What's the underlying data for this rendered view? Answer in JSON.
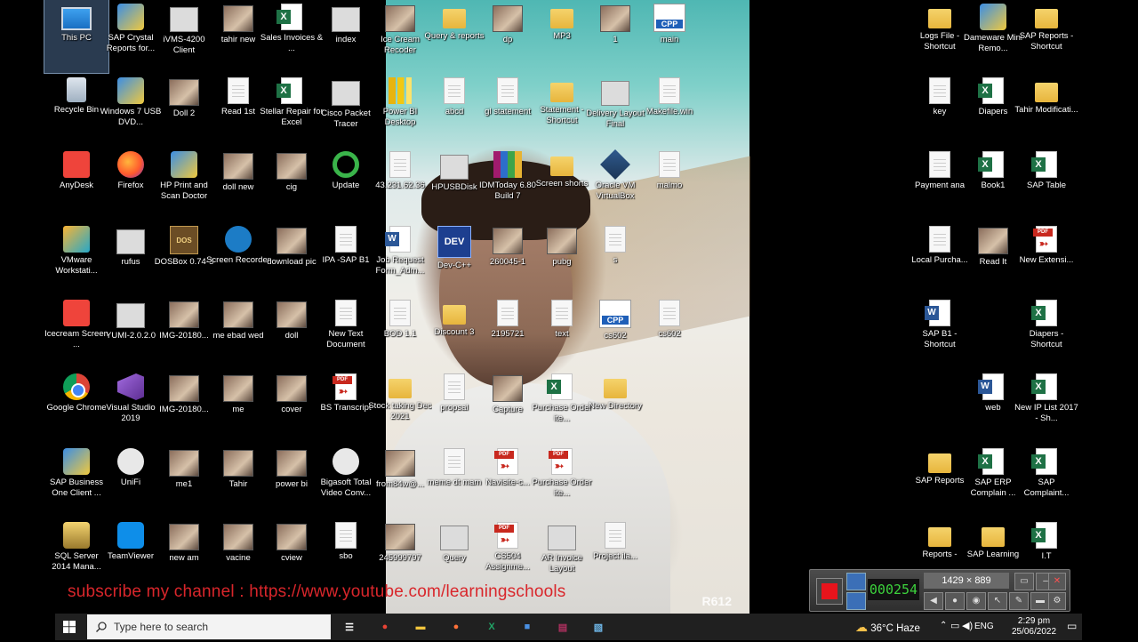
{
  "desktop": {
    "col1": [
      {
        "label": "This PC",
        "icon": "this-pc-icon",
        "type": "pc",
        "selected": true
      },
      {
        "label": "Recycle Bin",
        "icon": "recycle-bin-icon",
        "type": "recycle"
      },
      {
        "label": "AnyDesk",
        "icon": "anydesk-icon",
        "type": "any"
      },
      {
        "label": "VMware Workstati...",
        "icon": "vmware-icon",
        "type": "vmware"
      },
      {
        "label": "Icecream Screen ...",
        "icon": "icecream-icon",
        "type": "any"
      },
      {
        "label": "Google Chrome",
        "icon": "chrome-icon",
        "type": "chrome"
      },
      {
        "label": "SAP Business One Client ...",
        "icon": "sap-business-one-icon",
        "type": "shield"
      },
      {
        "label": "SQL Server 2014 Mana...",
        "icon": "sql-server-icon",
        "type": "sql"
      }
    ],
    "col2": [
      {
        "label": "SAP Crystal Reports for...",
        "icon": "crystal-reports-icon",
        "type": "shield"
      },
      {
        "label": "Windows 7 USB DVD...",
        "icon": "windows-usb-icon",
        "type": "shield"
      },
      {
        "label": "Firefox",
        "icon": "firefox-icon",
        "type": "firefox"
      },
      {
        "label": "rufus",
        "icon": "rufus-icon",
        "type": "gray"
      },
      {
        "label": "YUMI-2.0.2.0",
        "icon": "yumi-icon",
        "type": "gray"
      },
      {
        "label": "Visual Studio 2019",
        "icon": "visual-studio-icon",
        "type": "vs"
      },
      {
        "label": "UniFi",
        "icon": "unifi-icon",
        "type": "whiteround"
      },
      {
        "label": "TeamViewer",
        "icon": "teamviewer-icon",
        "type": "teamviewer"
      }
    ],
    "col3": [
      {
        "label": "iVMS-4200 Client",
        "icon": "ivms-icon",
        "type": "gray"
      },
      {
        "label": "Doll 2",
        "icon": "image-icon",
        "type": "photo"
      },
      {
        "label": "HP Print and Scan Doctor",
        "icon": "hp-doctor-icon",
        "type": "shield"
      },
      {
        "label": "DOSBox 0.74-3",
        "icon": "dosbox-icon",
        "type": "box",
        "glyph": "DOS"
      },
      {
        "label": "IMG-20180...",
        "icon": "image-icon",
        "type": "photo"
      },
      {
        "label": "IMG-20180...",
        "icon": "image-icon",
        "type": "photo"
      },
      {
        "label": "me1",
        "icon": "image-icon",
        "type": "photo"
      },
      {
        "label": "new am",
        "icon": "image-icon",
        "type": "photo"
      }
    ],
    "col4": [
      {
        "label": "tahir new",
        "icon": "image-icon",
        "type": "photo"
      },
      {
        "label": "Read 1st",
        "icon": "text-file-icon",
        "type": "doc"
      },
      {
        "label": "doll new",
        "icon": "image-icon",
        "type": "photo"
      },
      {
        "label": "Screen Recorder",
        "icon": "screen-recorder-icon",
        "type": "blue"
      },
      {
        "label": "me ebad wed",
        "icon": "image-icon",
        "type": "photo"
      },
      {
        "label": "me",
        "icon": "image-icon",
        "type": "photo"
      },
      {
        "label": "Tahir",
        "icon": "image-icon",
        "type": "photo"
      },
      {
        "label": "vacine",
        "icon": "image-icon",
        "type": "photo"
      }
    ],
    "col5": [
      {
        "label": "Sales Invoices & ...",
        "icon": "excel-file-icon",
        "type": "xls"
      },
      {
        "label": "Stellar Repair for Excel",
        "icon": "stellar-repair-icon",
        "type": "xls"
      },
      {
        "label": "cig",
        "icon": "image-icon",
        "type": "photo"
      },
      {
        "label": "download pic",
        "icon": "image-icon",
        "type": "photo"
      },
      {
        "label": "doll",
        "icon": "image-icon",
        "type": "photo"
      },
      {
        "label": "cover",
        "icon": "image-icon",
        "type": "photo"
      },
      {
        "label": "power bi",
        "icon": "image-icon",
        "type": "photo"
      },
      {
        "label": "cview",
        "icon": "image-icon",
        "type": "photo"
      }
    ],
    "col6": [
      {
        "label": "index",
        "icon": "html-file-icon",
        "type": "gray"
      },
      {
        "label": "Cisco Packet Tracer",
        "icon": "cisco-icon",
        "type": "gray"
      },
      {
        "label": "Update",
        "icon": "update-icon",
        "type": "greenarrows"
      },
      {
        "label": "IPA -SAP B1",
        "icon": "text-file-icon",
        "type": "doc"
      },
      {
        "label": "New Text Document",
        "icon": "text-file-icon",
        "type": "doc"
      },
      {
        "label": "BS Transcript",
        "icon": "pdf-icon",
        "type": "pdf"
      },
      {
        "label": "Bigasoft Total Video Conv...",
        "icon": "bigasoft-icon",
        "type": "whiteround"
      },
      {
        "label": "sbo",
        "icon": "text-file-icon",
        "type": "doc"
      }
    ],
    "col7": [
      {
        "label": "Ice Cream Recoder",
        "icon": "image-icon",
        "type": "photo"
      },
      {
        "label": "Power BI Desktop",
        "icon": "power-bi-icon",
        "type": "powerbi"
      },
      {
        "label": "43.231.62.36",
        "icon": "text-file-icon",
        "type": "doc"
      },
      {
        "label": "Job Request Form_Adm...",
        "icon": "word-file-icon",
        "type": "word"
      },
      {
        "label": "BOD 1.1",
        "icon": "text-file-icon",
        "type": "doc"
      },
      {
        "label": "Stock taking Dec 2021",
        "icon": "folder-icon",
        "type": "folder"
      },
      {
        "label": "from84w@...",
        "icon": "image-icon",
        "type": "photo"
      },
      {
        "label": "245999797",
        "icon": "image-icon",
        "type": "photo"
      }
    ],
    "col8": [
      {
        "label": "Query & reports",
        "icon": "folder-icon",
        "type": "folder"
      },
      {
        "label": "abcd",
        "icon": "text-file-icon",
        "type": "doc"
      },
      {
        "label": "HPUSBDisk",
        "icon": "hpusbdisk-icon",
        "type": "gray"
      },
      {
        "label": "Dev-C++",
        "icon": "devcpp-icon",
        "type": "dev",
        "glyph": "DEV"
      },
      {
        "label": "Discount 3",
        "icon": "folder-icon",
        "type": "folder"
      },
      {
        "label": "propsal",
        "icon": "text-file-icon",
        "type": "doc"
      },
      {
        "label": "meme dt mam",
        "icon": "text-file-icon",
        "type": "doc"
      },
      {
        "label": "Query",
        "icon": "image-icon",
        "type": "gray"
      }
    ],
    "col9": [
      {
        "label": "dp",
        "icon": "image-icon",
        "type": "photo"
      },
      {
        "label": "gl statement",
        "icon": "text-file-icon",
        "type": "doc"
      },
      {
        "label": "IDMToday 6.80 Build 7",
        "icon": "winrar-icon",
        "type": "rar"
      },
      {
        "label": "260045-1",
        "icon": "image-icon",
        "type": "photo"
      },
      {
        "label": "2195721",
        "icon": "text-file-icon",
        "type": "doc"
      },
      {
        "label": "Capture",
        "icon": "image-icon",
        "type": "photo"
      },
      {
        "label": "Navisite-c...",
        "icon": "pdf-icon",
        "type": "pdf"
      },
      {
        "label": "CS504 Assignme...",
        "icon": "pdf-icon",
        "type": "pdf"
      }
    ],
    "col10": [
      {
        "label": "MP3",
        "icon": "folder-icon",
        "type": "folder"
      },
      {
        "label": "Statement - Shortcut",
        "icon": "folder-icon",
        "type": "folder"
      },
      {
        "label": "Screen shorts",
        "icon": "folder-icon",
        "type": "folder"
      },
      {
        "label": "pubg",
        "icon": "image-icon",
        "type": "photo"
      },
      {
        "label": "text",
        "icon": "text-file-icon",
        "type": "doc"
      },
      {
        "label": "Purchase Order ite...",
        "icon": "excel-file-icon",
        "type": "xls"
      },
      {
        "label": "Purchase Order ite...",
        "icon": "pdf-icon",
        "type": "pdf"
      },
      {
        "label": "AR Invoice Layout",
        "icon": "layout-icon",
        "type": "gray"
      }
    ],
    "col11": [
      {
        "label": "1",
        "icon": "image-icon",
        "type": "photo"
      },
      {
        "label": "Delivery Layout Final",
        "icon": "layout-icon",
        "type": "gray"
      },
      {
        "label": "Oracle VM VirtualBox",
        "icon": "virtualbox-icon",
        "type": "vbox"
      },
      {
        "label": "s",
        "icon": "text-file-icon",
        "type": "doc"
      },
      {
        "label": "cs602",
        "icon": "cpp-file-icon",
        "type": "cpp"
      },
      {
        "label": "New Directory",
        "icon": "folder-icon",
        "type": "folder"
      },
      {
        "label": "",
        "icon": "",
        "type": "none"
      },
      {
        "label": "Project ila...",
        "icon": "text-file-icon",
        "type": "doc"
      }
    ],
    "col12": [
      {
        "label": "main",
        "icon": "cpp-file-icon",
        "type": "cpp"
      },
      {
        "label": "Makefile.win",
        "icon": "text-file-icon",
        "type": "doc"
      },
      {
        "label": "malmo",
        "icon": "text-file-icon",
        "type": "doc"
      },
      {
        "label": "",
        "icon": "",
        "type": "none"
      },
      {
        "label": "cs602",
        "icon": "text-file-icon",
        "type": "doc"
      }
    ],
    "colR1": [
      {
        "label": "Logs File - Shortcut",
        "icon": "folder-icon",
        "type": "folder"
      },
      {
        "label": "key",
        "icon": "text-file-icon",
        "type": "doc"
      },
      {
        "label": "Payment ana",
        "icon": "text-file-icon",
        "type": "doc"
      },
      {
        "label": "Local Purcha...",
        "icon": "text-file-icon",
        "type": "doc"
      },
      {
        "label": "SAP B1 - Shortcut",
        "icon": "word-file-icon",
        "type": "word"
      },
      {
        "label": "",
        "icon": "",
        "type": "none"
      },
      {
        "label": "SAP Reports",
        "icon": "folder-icon",
        "type": "folder"
      },
      {
        "label": "Reports -",
        "icon": "folder-icon",
        "type": "folder"
      }
    ],
    "colR2": [
      {
        "label": "Dameware Mini Remo...",
        "icon": "dameware-icon",
        "type": "shield"
      },
      {
        "label": "Diapers",
        "icon": "excel-file-icon",
        "type": "xls"
      },
      {
        "label": "Book1",
        "icon": "excel-file-icon",
        "type": "xls"
      },
      {
        "label": "Read It",
        "icon": "image-icon",
        "type": "photo"
      },
      {
        "label": "",
        "icon": "",
        "type": "none"
      },
      {
        "label": "web",
        "icon": "word-file-icon",
        "type": "word"
      },
      {
        "label": "SAP ERP Complain ...",
        "icon": "excel-file-icon",
        "type": "xls"
      },
      {
        "label": "SAP Learning",
        "icon": "folder-icon",
        "type": "folder"
      }
    ],
    "colR3": [
      {
        "label": "SAP Reports - Shortcut",
        "icon": "folder-icon",
        "type": "folder"
      },
      {
        "label": "Tahir Modificati...",
        "icon": "folder-icon",
        "type": "folder"
      },
      {
        "label": "SAP Table",
        "icon": "excel-file-icon",
        "type": "xls"
      },
      {
        "label": "New Extensi...",
        "icon": "pdf-icon",
        "type": "pdf"
      },
      {
        "label": "Diapers - Shortcut",
        "icon": "excel-file-icon",
        "type": "xls"
      },
      {
        "label": "New IP List 2017 - Sh...",
        "icon": "excel-file-icon",
        "type": "xls"
      },
      {
        "label": "SAP Complaint...",
        "icon": "excel-file-icon",
        "type": "xls"
      },
      {
        "label": "I.T",
        "icon": "excel-file-icon",
        "type": "xls"
      }
    ]
  },
  "overlay": {
    "subscribe_text": "subscribe my channel : https://www.youtube.com/learningschools",
    "wallpaper_tag": "R612"
  },
  "recorder": {
    "timer": "000254",
    "resolution": "1429 × 889"
  },
  "taskbar": {
    "search_placeholder": "Type here to search",
    "apps": [
      {
        "name": "task-view-icon",
        "glyph": "☰",
        "color": "#ffffff"
      },
      {
        "name": "chrome-taskbar-icon",
        "glyph": "●",
        "color": "#e84335"
      },
      {
        "name": "file-explorer-taskbar-icon",
        "glyph": "▬",
        "color": "#f2c53d"
      },
      {
        "name": "firefox-taskbar-icon",
        "glyph": "●",
        "color": "#ff7139"
      },
      {
        "name": "excel-taskbar-icon",
        "glyph": "X",
        "color": "#21a366"
      },
      {
        "name": "sap-taskbar-icon",
        "glyph": "■",
        "color": "#4a90e2"
      },
      {
        "name": "winrar-taskbar-icon",
        "glyph": "▤",
        "color": "#b03060"
      },
      {
        "name": "notepad-taskbar-icon",
        "glyph": "▧",
        "color": "#6fb7e8"
      }
    ],
    "weather": "36°C  Haze",
    "language": "ENG",
    "time": "2:29 pm",
    "date": "25/06/2022"
  }
}
